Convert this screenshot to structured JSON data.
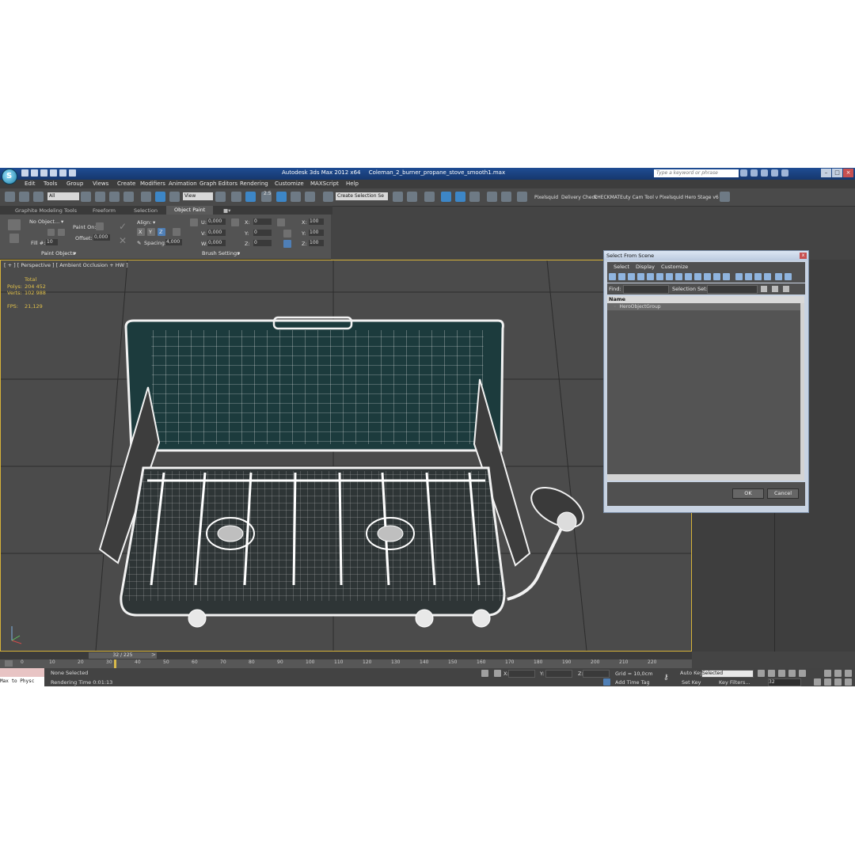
{
  "window": {
    "app_title": "Autodesk 3ds Max  2012 x64",
    "file_title": "Coleman_2_burner_propane_stove_smooth1.max",
    "search_placeholder": "Type a keyword or phrase",
    "logo_letter": "S"
  },
  "menu": [
    "Edit",
    "Tools",
    "Group",
    "Views",
    "Create",
    "Modifiers",
    "Animation",
    "Graph Editors",
    "Rendering",
    "Customize",
    "MAXScript",
    "Help"
  ],
  "toolbar": {
    "filter_value": "All",
    "coord_value": "View",
    "selection_set_value": "Create Selection Se",
    "snap_label": "2.5",
    "plugins": [
      "Pixelsquid",
      "Delivery Check",
      "CHECKMATE",
      "uty Cam Tool v",
      "Pixelsquid",
      "Hero Stage v6"
    ]
  },
  "ribbon": {
    "tabs": [
      "Graphite Modeling Tools",
      "Freeform",
      "Selection",
      "Object Paint"
    ],
    "no_object_label": "No Object...",
    "paint_on_label": "Paint On:",
    "fill_label": "Fill #:",
    "fill_value": "10",
    "offset_label": "Offset:",
    "offset_value": "0,000",
    "align_label": "Align:",
    "axis_x": "X",
    "axis_y": "Y",
    "axis_z": "Z",
    "spacing_label": "Spacing:",
    "spacing_value": "4,000",
    "u_label": "U:",
    "u_value": "0,000",
    "v_label": "V:",
    "v_value": "0,000",
    "w_label": "W:",
    "w_value": "0,000",
    "x_label": "X:",
    "x_value": "0",
    "y_label": "Y:",
    "y_value": "0",
    "z_label": "Z:",
    "z_value": "0",
    "sx_label": "X:",
    "sx_value": "100",
    "sy_label": "Y:",
    "sy_value": "100",
    "sz_label": "Z:",
    "sz_value": "100",
    "group1": "Paint Objects",
    "group2": "Brush Settings"
  },
  "viewport": {
    "label": "[ + ] [ Perspective ] [ Ambient Occlusion + HW ]",
    "stats_header": "Total",
    "polys_label": "Polys:",
    "polys_value": "204 452",
    "verts_label": "Verts:",
    "verts_value": "102 988",
    "fps_label": "FPS:",
    "fps_value": "21,129"
  },
  "dialog": {
    "title": "Select From Scene",
    "close": "x",
    "menu": [
      "Select",
      "Display",
      "Customize"
    ],
    "find_label": "Find:",
    "selection_set_label": "Selection Set:",
    "column_name": "Name",
    "items": [
      "HeroObjectGroup"
    ],
    "ok_label": "OK",
    "cancel_label": "Cancel"
  },
  "timeline": {
    "frame_indicator": "32 / 225",
    "ticks": [
      "0",
      "10",
      "20",
      "30",
      "40",
      "50",
      "60",
      "70",
      "80",
      "90",
      "100",
      "110",
      "120",
      "130",
      "140",
      "150",
      "160",
      "170",
      "180",
      "190",
      "200",
      "210",
      "220"
    ]
  },
  "status": {
    "maxscript_text": "Max to Physc",
    "selection_status": "None Selected",
    "rendering_time": "Rendering Time  0:01:13",
    "x_label": "X:",
    "y_label": "Y:",
    "z_label": "Z:",
    "grid": "Grid = 10,0cm",
    "add_time_tag": "Add Time Tag",
    "auto_key": "Auto Key",
    "set_key": "Set Key",
    "selected_value": "Selected",
    "key_filters": "Key Filters...",
    "frame_value": "32"
  }
}
